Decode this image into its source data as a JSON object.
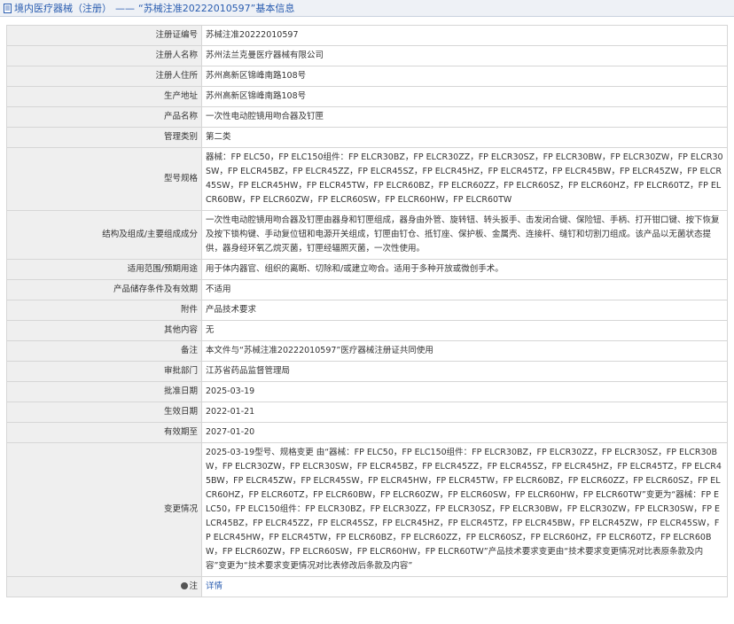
{
  "header": {
    "category": "境内医疗器械（注册）",
    "separator": "——",
    "subject": "“苏械注准20222010597”基本信息"
  },
  "rows": [
    {
      "label": "注册证编号",
      "value": "苏械注准20222010597"
    },
    {
      "label": "注册人名称",
      "value": "苏州法兰克曼医疗器械有限公司"
    },
    {
      "label": "注册人住所",
      "value": "苏州高新区锦峰南路108号"
    },
    {
      "label": "生产地址",
      "value": "苏州高新区锦峰南路108号"
    },
    {
      "label": "产品名称",
      "value": "一次性电动腔镜用吻合器及钉匣"
    },
    {
      "label": "管理类别",
      "value": "第二类"
    },
    {
      "label": "型号规格",
      "value": "器械：FP ELC50，FP ELC150组件：FP ELCR30BZ，FP ELCR30ZZ，FP ELCR30SZ，FP ELCR30BW，FP ELCR30ZW，FP ELCR30SW，FP ELCR45BZ，FP ELCR45ZZ，FP ELCR45SZ，FP ELCR45HZ，FP ELCR45TZ，FP ELCR45BW，FP ELCR45ZW，FP ELCR45SW，FP ELCR45HW，FP ELCR45TW，FP ELCR60BZ，FP ELCR60ZZ，FP ELCR60SZ，FP ELCR60HZ，FP ELCR60TZ，FP ELCR60BW，FP ELCR60ZW，FP ELCR60SW，FP ELCR60HW，FP ELCR60TW"
    },
    {
      "label": "结构及组成/主要组成成分",
      "value": "一次性电动腔镜用吻合器及钉匣由器身和钉匣组成，器身由外管、旋转钮、转头扳手、击发闭合键、保险钮、手柄、打开钳口键、按下恢复及按下锁构键、手动复位钮和电源开关组成，钉匣由钉仓、抵钉座、保护板、金属壳、连接杆、缝钉和切割刀组成。该产品以无菌状态提供，器身经环氧乙烷灭菌，钉匣经辐照灭菌，一次性使用。"
    },
    {
      "label": "适用范围/预期用途",
      "value": "用于体内器官、组织的离断、切除和/或建立吻合。适用于多种开放或微创手术。"
    },
    {
      "label": "产品储存条件及有效期",
      "value": "不适用"
    },
    {
      "label": "附件",
      "value": "产品技术要求"
    },
    {
      "label": "其他内容",
      "value": "无"
    },
    {
      "label": "备注",
      "value": "本文件与“苏械注准20222010597”医疗器械注册证共同使用"
    },
    {
      "label": "审批部门",
      "value": "江苏省药品监督管理局"
    },
    {
      "label": "批准日期",
      "value": "2025-03-19"
    },
    {
      "label": "生效日期",
      "value": "2022-01-21"
    },
    {
      "label": "有效期至",
      "value": "2027-01-20"
    },
    {
      "label": "变更情况",
      "value": "2025-03-19型号、规格变更 由“器械：FP ELC50，FP ELC150组件：FP ELCR30BZ，FP ELCR30ZZ，FP ELCR30SZ，FP ELCR30BW，FP ELCR30ZW，FP ELCR30SW，FP ELCR45BZ，FP ELCR45ZZ，FP ELCR45SZ，FP ELCR45HZ，FP ELCR45TZ，FP ELCR45BW，FP ELCR45ZW，FP ELCR45SW，FP ELCR45HW，FP ELCR45TW，FP ELCR60BZ，FP ELCR60ZZ，FP ELCR60SZ，FP ELCR60HZ，FP ELCR60TZ，FP ELCR60BW，FP ELCR60ZW，FP ELCR60SW，FP ELCR60HW，FP ELCR60TW”变更为“器械：FP ELC50，FP ELC150组件：FP ELCR30BZ，FP ELCR30ZZ，FP ELCR30SZ，FP ELCR30BW，FP ELCR30ZW，FP ELCR30SW，FP ELCR45BZ，FP ELCR45ZZ，FP ELCR45SZ，FP ELCR45HZ，FP ELCR45TZ，FP ELCR45BW，FP ELCR45ZW，FP ELCR45SW，FP ELCR45HW，FP ELCR45TW，FP ELCR60BZ，FP ELCR60ZZ，FP ELCR60SZ，FP ELCR60HZ，FP ELCR60TZ，FP ELCR60BW，FP ELCR60ZW，FP ELCR60SW，FP ELCR60HW，FP ELCR60TW”产品技术要求变更由“技术要求变更情况对比表原条款及内容”变更为“技术要求变更情况对比表修改后条款及内容”"
    }
  ],
  "note_row": {
    "label": "注",
    "link": "详情"
  },
  "colors": {
    "link": "#2a5db0",
    "label_bg": "#efefef",
    "border": "#d6d6d6"
  }
}
